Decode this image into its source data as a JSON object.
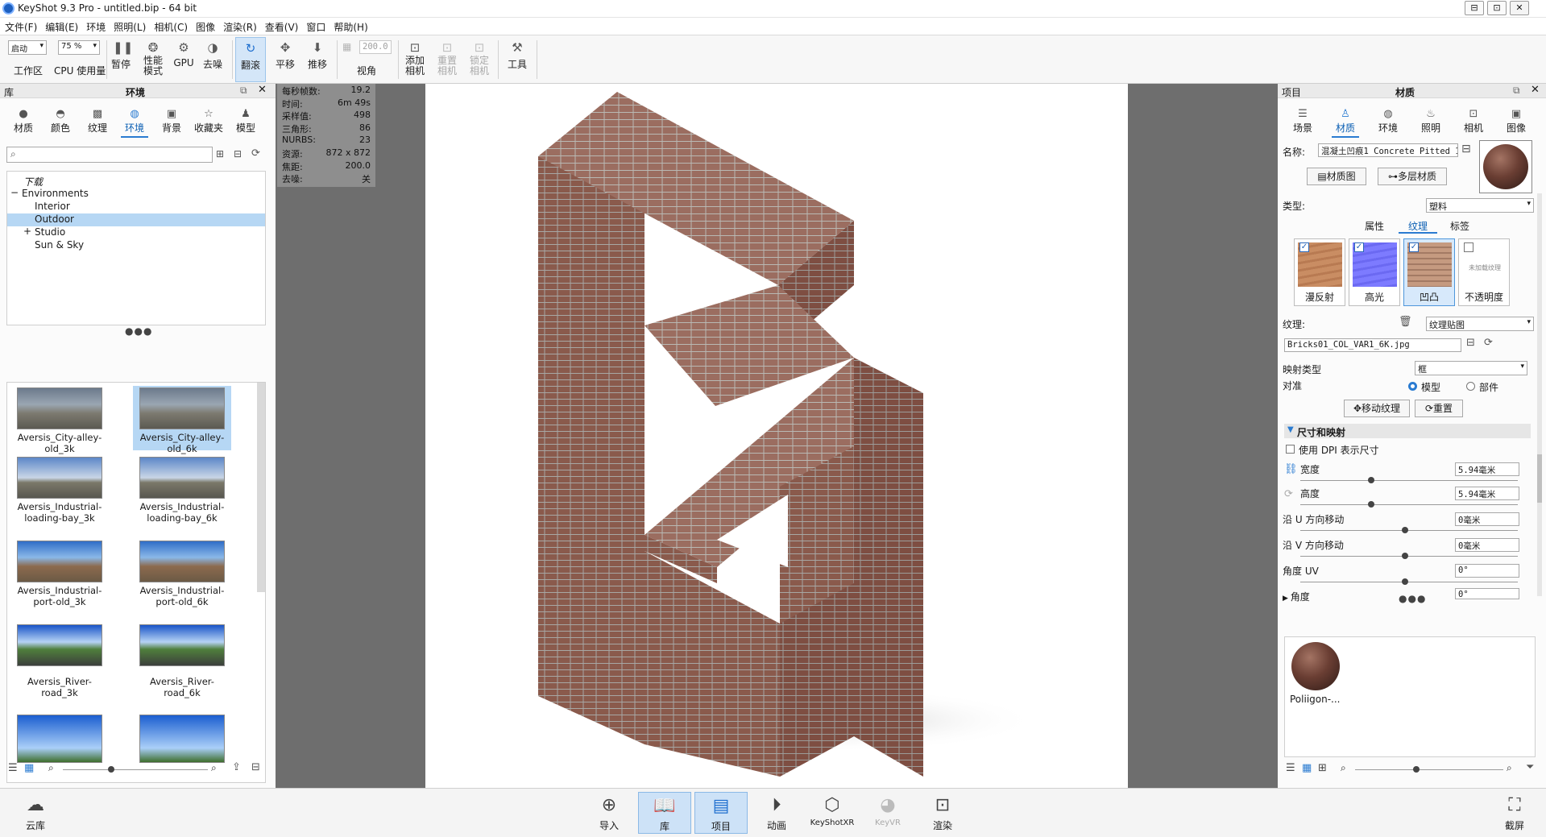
{
  "window": {
    "title": "KeyShot 9.3 Pro  - untitled.bip  - 64 bit",
    "controls": [
      "⊟",
      "⊡",
      "✕"
    ]
  },
  "menu": [
    "文件(F)",
    "编辑(E)",
    "环境",
    "照明(L)",
    "相机(C)",
    "图像",
    "渲染(R)",
    "查看(V)",
    "窗口",
    "帮助(H)"
  ],
  "toolbar": {
    "workspace_value": "启动",
    "workspace_label": "工作区",
    "cpu_value": "75 %",
    "cpu_label": "CPU 使用量",
    "pause": "暂停",
    "perf_mode_1": "性能",
    "perf_mode_2": "模式",
    "gpu": "GPU",
    "denoise": "去噪",
    "tumble": "翻滚",
    "pan": "平移",
    "dolly": "推移",
    "fov_value": "200.0",
    "perspective": "视角",
    "add_camera_1": "添加",
    "add_camera_2": "相机",
    "reset_camera_1": "重置",
    "reset_camera_2": "相机",
    "lock_camera_1": "锁定",
    "lock_camera_2": "相机",
    "tools": "工具"
  },
  "library": {
    "header_left": "库",
    "header_title": "环境",
    "tabs": [
      "材质",
      "颜色",
      "纹理",
      "环境",
      "背景",
      "收藏夹",
      "模型"
    ],
    "tree": [
      "下载",
      "Environments",
      "Interior",
      "Outdoor",
      "Studio",
      "Sun & Sky"
    ],
    "thumbs": [
      "Aversis_City-alley-old_3k",
      "Aversis_City-alley-old_6k",
      "Aversis_Industrial-loading-bay_3k",
      "Aversis_Industrial-loading-bay_6k",
      "Aversis_Industrial-port-old_3k",
      "Aversis_Industrial-port-old_6k",
      "Aversis_River-road_3k",
      "Aversis_River-road_6k"
    ]
  },
  "stats": [
    {
      "k": "每秒帧数:",
      "v": "19.2"
    },
    {
      "k": "时间:",
      "v": "6m 49s"
    },
    {
      "k": "采样值:",
      "v": "498"
    },
    {
      "k": "三角形:",
      "v": "86"
    },
    {
      "k": "NURBS:",
      "v": "23"
    },
    {
      "k": "资源:",
      "v": "872 x 872"
    },
    {
      "k": "焦距:",
      "v": "200.0"
    },
    {
      "k": "去噪:",
      "v": "关"
    }
  ],
  "project": {
    "header_left": "项目",
    "header_title": "材质",
    "tabs": [
      "场景",
      "材质",
      "环境",
      "照明",
      "相机",
      "图像"
    ],
    "name_label": "名称:",
    "name_value": "混凝土凹痕1 Concrete Pitted 1",
    "material_graph": "材质图",
    "multi_material": "多层材质",
    "type_label": "类型:",
    "type_value": "塑料",
    "subtabs": [
      "属性",
      "纹理",
      "标签"
    ],
    "slots": [
      "漫反射",
      "高光",
      "凹凸",
      "不透明度"
    ],
    "empty_slot_text": "未加载纹理",
    "texture_label": "纹理:",
    "texture_type": "纹理贴图",
    "texture_file": "Bricks01_COL_VAR1_6K.jpg",
    "mapping_label": "映射类型",
    "mapping_value": "框",
    "align_label": "对准",
    "align_model": "模型",
    "align_part": "部件",
    "move_texture": "移动纹理",
    "reset": "重置",
    "section": "尺寸和映射",
    "use_dpi": "使用 DPI 表示尺寸",
    "width_label": "宽度",
    "width_value": "5.94毫米",
    "height_label": "高度",
    "height_value": "5.94毫米",
    "shift_u_label": "沿 U 方向移动",
    "shift_u_value": "0毫米",
    "shift_v_label": "沿 V 方向移动",
    "shift_v_value": "0毫米",
    "angle_uv_label": "角度 UV",
    "angle_uv_value": "0°",
    "angle_label": "角度",
    "angle_value": "0°",
    "preview_label": "Poliigon-..."
  },
  "bottombar": {
    "cloud": "云库",
    "import": "导入",
    "library": "库",
    "project": "项目",
    "animation": "动画",
    "keyshotxr": "KeyShotXR",
    "keyvr": "KeyVR",
    "render": "渲染",
    "screenshot": "截屏"
  },
  "colors": {
    "accent": "#2a7bd1",
    "selection": "#b6d7f4",
    "viewport_bg": "#6e6e6e",
    "stats_bg": "#8e8e8e"
  }
}
